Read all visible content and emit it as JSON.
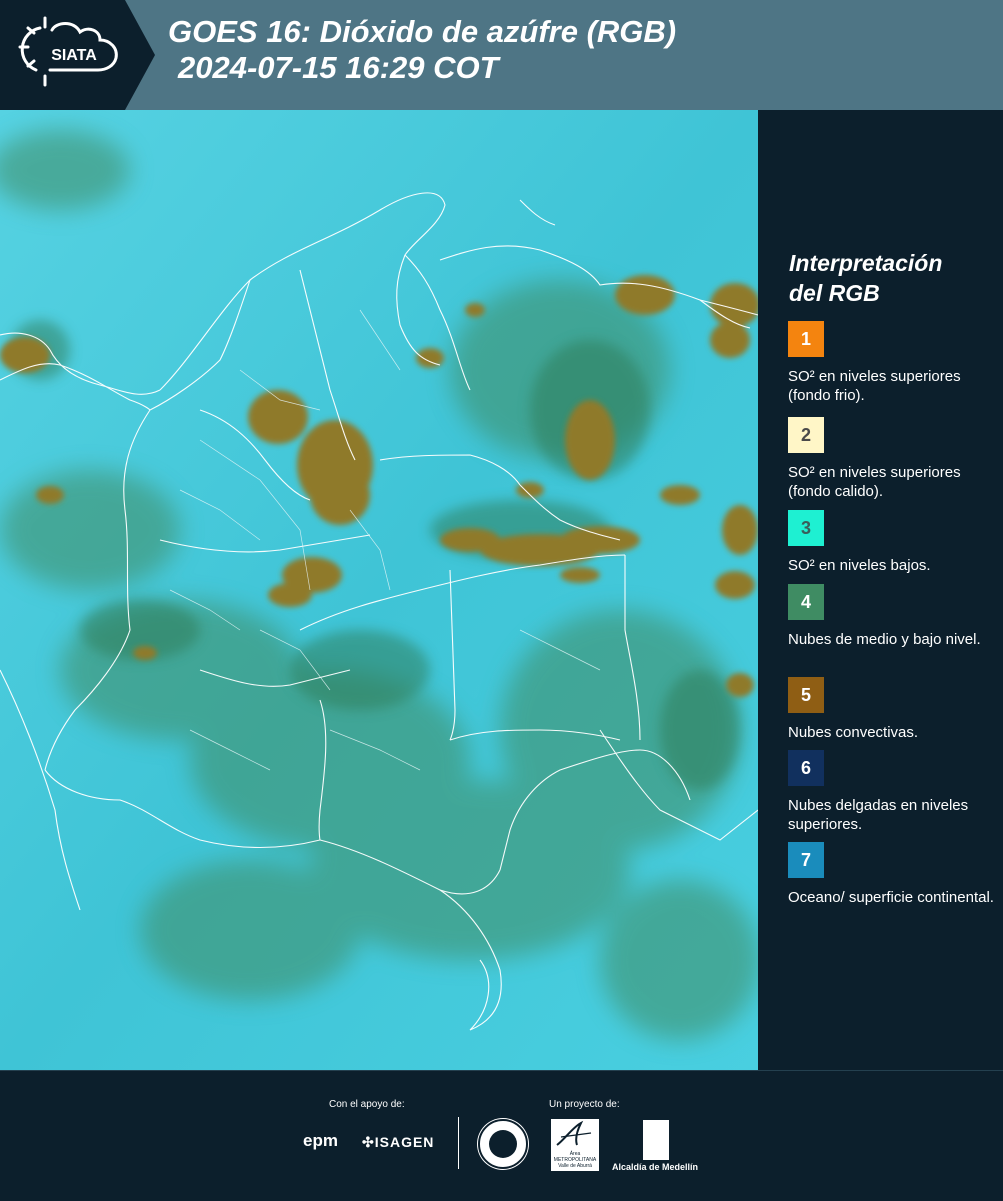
{
  "header": {
    "logo_text": "SIATA",
    "title_line1": "GOES 16: Dióxido de azúfre (RGB)",
    "title_line2": "2024-07-15 16:29 COT"
  },
  "legend": {
    "title_line1": "Interpretación",
    "title_line2": "del RGB",
    "items": [
      {
        "number": "1",
        "color": "#f4840f",
        "number_color": "#ffffff",
        "text": "SO² en niveles superiores (fondo frio)."
      },
      {
        "number": "2",
        "color": "#fff6c7",
        "number_color": "#4a4a4a",
        "text": "SO² en niveles superiores (fondo calido)."
      },
      {
        "number": "3",
        "color": "#1ef0d2",
        "number_color": "#3a5e5a",
        "text": "SO² en niveles bajos."
      },
      {
        "number": "4",
        "color": "#3f8c63",
        "number_color": "#ffffff",
        "text": "Nubes de medio y bajo nivel."
      },
      {
        "number": "5",
        "color": "#8f5e14",
        "number_color": "#ffffff",
        "text": "Nubes convectivas."
      },
      {
        "number": "6",
        "color": "#11305e",
        "number_color": "#ffffff",
        "text": "Nubes delgadas en niveles superiores."
      },
      {
        "number": "7",
        "color": "#1a8cbc",
        "number_color": "#ffffff",
        "text": "Oceano/ superficie continental."
      }
    ]
  },
  "footer": {
    "support_label": "Con el apoyo de:",
    "project_label": "Un proyecto de:",
    "epm": "epm",
    "isagen": "ISAGEN",
    "area_logo": "Área METROPOLITANA Valle de Aburrá",
    "alcaldia": "Alcaldía de Medellín"
  }
}
